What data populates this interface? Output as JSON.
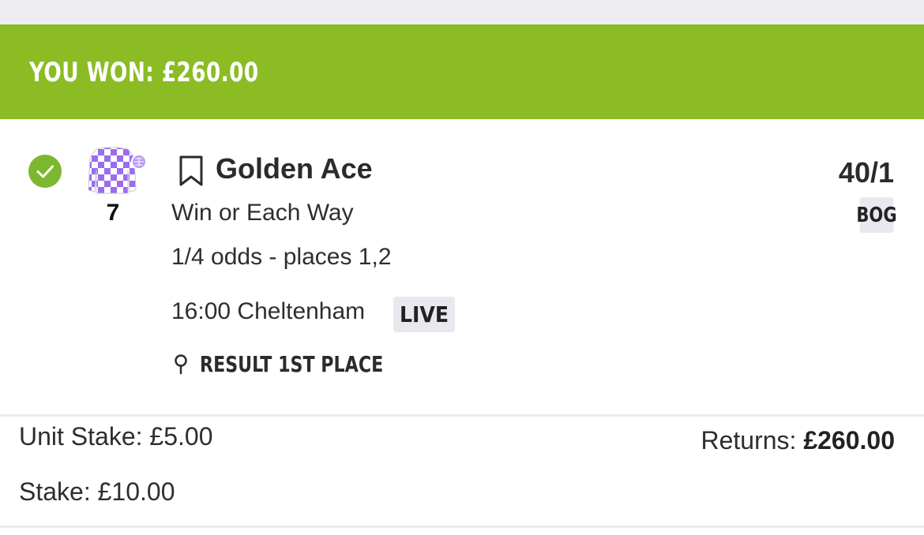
{
  "banner": {
    "text": "YOU WON: £260.00",
    "color": "#8bbc24"
  },
  "selection": {
    "status_icon": "check-circle-icon",
    "runner_number": "7",
    "silks_colors": [
      "#ffffff",
      "#9b6cf0"
    ],
    "name": "Golden Ace",
    "bet_type": "Win or Each Way",
    "each_way_terms": "1/4 odds - places 1,2",
    "race": "16:00 Cheltenham",
    "live_badge": "LIVE",
    "result": "RESULT 1ST PLACE",
    "odds": "40/1",
    "bog_badge": "BOG"
  },
  "footer": {
    "unit_stake": "Unit Stake: £5.00",
    "stake": "Stake: £10.00",
    "returns_label": "Returns:",
    "returns_value": "£260.00"
  }
}
